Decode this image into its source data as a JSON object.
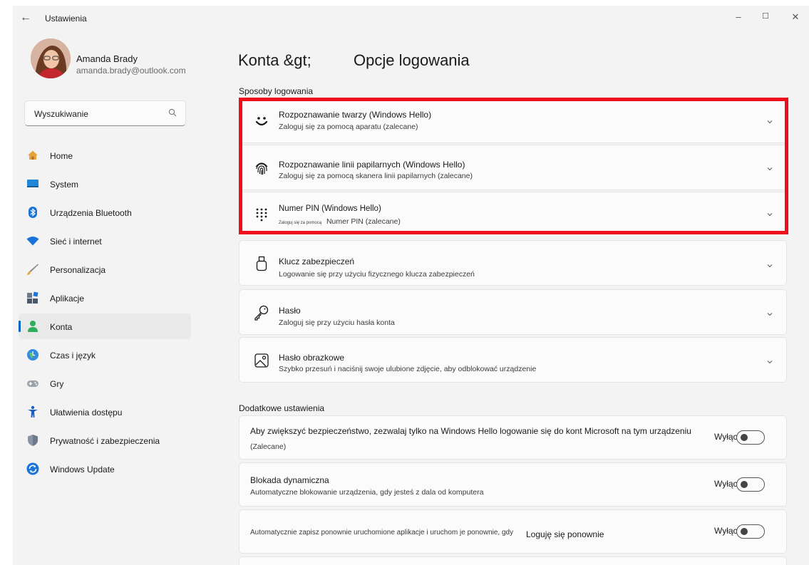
{
  "window": {
    "title": "Ustawienia"
  },
  "user": {
    "name": "Amanda Brady",
    "email": "amanda.brady@outlook.com"
  },
  "search": {
    "placeholder": "Wyszukiwanie"
  },
  "sidebar": {
    "items": [
      {
        "label": "Home",
        "icon": "home-icon"
      },
      {
        "label": "System",
        "icon": "system-icon"
      },
      {
        "label": "Urządzenia Bluetooth",
        "icon": "bluetooth-icon"
      },
      {
        "label": "Sieć i internet",
        "icon": "wifi-icon"
      },
      {
        "label": "Personalizacja",
        "icon": "brush-icon"
      },
      {
        "label": "Aplikacje",
        "icon": "apps-icon"
      },
      {
        "label": "Konta",
        "icon": "account-icon",
        "active": true
      },
      {
        "label": "Czas i język",
        "icon": "globe-clock-icon"
      },
      {
        "label": "Gry",
        "icon": "gamepad-icon"
      },
      {
        "label": "Ułatwienia dostępu",
        "icon": "accessibility-icon"
      },
      {
        "label": "Prywatność i zabezpieczenia",
        "icon": "shield-icon"
      },
      {
        "label": "Windows Update",
        "icon": "update-icon"
      }
    ]
  },
  "header": {
    "breadcrumb": "Konta &gt;",
    "title": "Opcje logowania"
  },
  "sections": {
    "sign_in": "Sposoby logowania",
    "additional": "Dodatkowe ustawienia"
  },
  "sign_in_options": [
    {
      "title": "Rozpoznawanie twarzy (Windows Hello)",
      "desc": "Zaloguj się za pomocą aparatu (zalecane)",
      "icon": "face-icon"
    },
    {
      "title": "Rozpoznawanie linii papilarnych (Windows Hello)",
      "desc": "Zaloguj się za pomocą skanera linii papilarnych (zalecane)",
      "icon": "fingerprint-icon"
    },
    {
      "title": "Numer PIN (Windows Hello)",
      "desc_small": "Zaloguj się za pomocą",
      "desc": "Numer PIN (zalecane)",
      "icon": "pin-keypad-icon"
    },
    {
      "title": "Klucz zabezpieczeń",
      "desc": "Logowanie się przy użyciu fizycznego klucza zabezpieczeń",
      "icon": "usb-key-icon"
    },
    {
      "title": "Hasło",
      "desc": "Zaloguj się przy użyciu hasła konta",
      "icon": "key-icon"
    },
    {
      "title": "Hasło obrazkowe",
      "desc": "Szybko przesuń i naciśnij swoje ulubione zdjęcie, aby odblokować urządzenie",
      "icon": "picture-password-icon"
    }
  ],
  "additional_settings": [
    {
      "title": "Aby zwiększyć bezpieczeństwo, zezwalaj tylko na Windows Hello logowanie się do kont Microsoft na tym urządzeniu",
      "desc": "(Zalecane)",
      "toggle_label": "Wyłączone",
      "state": "off"
    },
    {
      "title": "Blokada dynamiczna",
      "desc": "Automatyczne blokowanie urządzenia, gdy jesteś z dala od komputera",
      "toggle_label": "Wyłączone",
      "state": "off"
    },
    {
      "title": "Automatycznie zapisz ponownie uruchomione aplikacje i uruchom je ponownie, gdy",
      "extra": "Loguję się ponownie",
      "toggle_label": "Wyłączone",
      "state": "off"
    }
  ],
  "colors": {
    "accent": "#0067c0",
    "highlight": "#ee0f1b",
    "background": "#f3f3f3",
    "card": "#fbfbfb"
  }
}
